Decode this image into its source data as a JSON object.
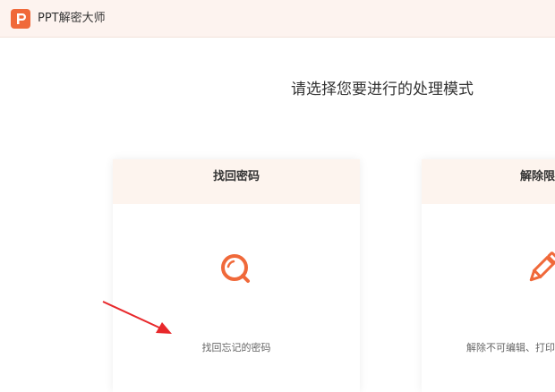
{
  "app": {
    "title": "PPT解密大师",
    "logo_icon": "ppt-logo-icon",
    "accent_color": "#f0693a"
  },
  "heading": "请选择您要进行的处理模式",
  "cards": [
    {
      "title": "找回密码",
      "icon": "magnifier-icon",
      "description": "找回忘记的密码"
    },
    {
      "title": "解除限",
      "icon": "pencil-icon",
      "description": "解除不可编辑、打印"
    }
  ],
  "annotation": {
    "icon": "red-arrow-icon",
    "color": "#e8282b"
  }
}
